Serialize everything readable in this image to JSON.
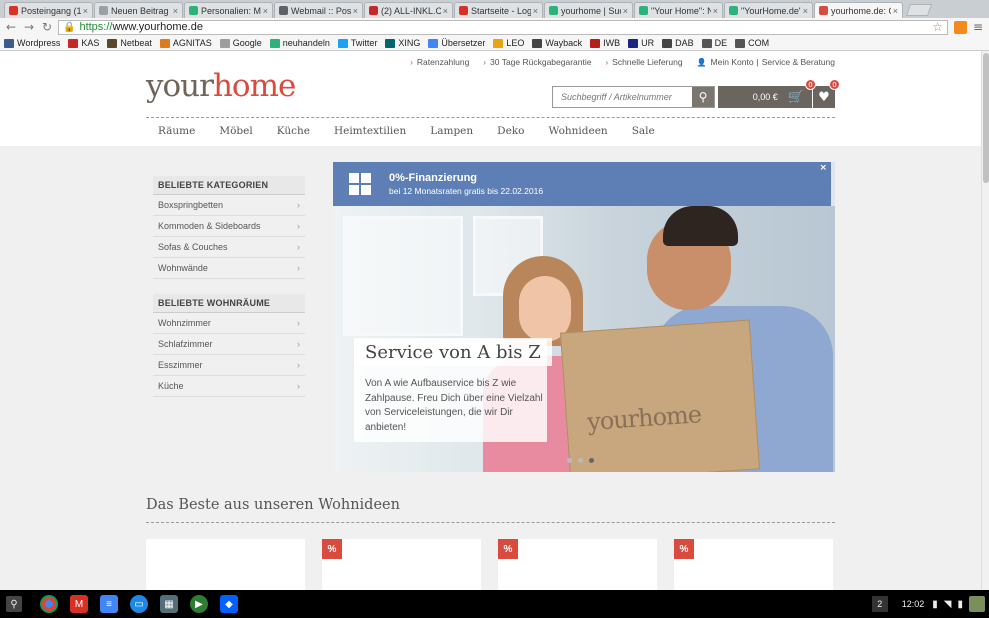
{
  "browser": {
    "tabs": [
      {
        "label": "Posteingang (1) -",
        "color": "#d93025"
      },
      {
        "label": "Neuen Beitrag ers",
        "color": "#9aa0a6"
      },
      {
        "label": "Personalien: Miste",
        "color": "#2db37a"
      },
      {
        "label": "Webmail :: Posteir",
        "color": "#5f6368"
      },
      {
        "label": "(2) ALL-INKL.COM",
        "color": "#c62828"
      },
      {
        "label": "Startseite - LogRe",
        "color": "#d93025"
      },
      {
        "label": "yourhome | Suche",
        "color": "#2db37a"
      },
      {
        "label": "\"Your Home\": Neu",
        "color": "#2db37a"
      },
      {
        "label": "\"YourHome.de\": h",
        "color": "#2db37a"
      },
      {
        "label": "yourhome.de: Onli",
        "color": "#d94b3f"
      }
    ],
    "url_scheme": "https://",
    "url_host": "www.yourhome.de",
    "bookmarks": [
      {
        "label": "Wordpress",
        "color": "#3b5b8c"
      },
      {
        "label": "KAS",
        "color": "#c62828"
      },
      {
        "label": "Netbeat",
        "color": "#5a4a2a"
      },
      {
        "label": "AGNITAS",
        "color": "#e07a1f"
      },
      {
        "label": "Google",
        "color": "#9e9e9e"
      },
      {
        "label": "neuhandeln",
        "color": "#2db37a"
      },
      {
        "label": "Twitter",
        "color": "#1da1f2"
      },
      {
        "label": "XING",
        "color": "#006567"
      },
      {
        "label": "Übersetzer",
        "color": "#4285f4"
      },
      {
        "label": "LEO",
        "color": "#e8a317"
      },
      {
        "label": "Wayback",
        "color": "#444444"
      },
      {
        "label": "IWB",
        "color": "#b71c1c"
      },
      {
        "label": "UR",
        "color": "#1a237e"
      },
      {
        "label": "DAB",
        "color": "#444444"
      },
      {
        "label": "DE",
        "color": "#555555"
      },
      {
        "label": "COM",
        "color": "#555555"
      }
    ]
  },
  "site": {
    "logo_part1": "your",
    "logo_part2": "home",
    "meta_links": {
      "ratenzahlung": "Ratenzahlung",
      "rueckgabe": "30 Tage Rückgabegarantie",
      "lieferung": "Schnelle Lieferung",
      "konto": "Mein Konto",
      "service": "Service & Beratung"
    },
    "search_placeholder": "Suchbegriff / Artikelnummer",
    "cart_total": "0,00 €",
    "cart_count": "0",
    "wishlist_count": "0",
    "nav": [
      "Räume",
      "Möbel",
      "Küche",
      "Heimtextilien",
      "Lampen",
      "Deko",
      "Wohnideen",
      "Sale"
    ],
    "sidebar": {
      "categories_title": "BELIEBTE KATEGORIEN",
      "categories": [
        "Boxspringbetten",
        "Kommoden & Sideboards",
        "Sofas & Couches",
        "Wohnwände"
      ],
      "rooms_title": "BELIEBTE WOHNRÄUME",
      "rooms": [
        "Wohnzimmer",
        "Schlafzimmer",
        "Esszimmer",
        "Küche"
      ]
    },
    "promo": {
      "title": "0%-Finanzierung",
      "subtitle": "bei 12 Monatsraten gratis bis 22.02.2016",
      "close": "×"
    },
    "hero": {
      "title": "Service von A bis Z",
      "description": "Von A wie Aufbauservice bis Z wie Zahlpause. Freu Dich über eine Vielzahl von Serviceleistungen, die wir Dir anbieten!",
      "box_logo": "yourhome",
      "active_slide": 3,
      "slide_count": 3
    },
    "section_title": "Das Beste aus unseren Wohnideen",
    "products": [
      {
        "badge": ""
      },
      {
        "badge": "%"
      },
      {
        "badge": "%"
      },
      {
        "badge": "%"
      }
    ]
  },
  "taskbar": {
    "window_count": "2",
    "clock": "12:02"
  }
}
